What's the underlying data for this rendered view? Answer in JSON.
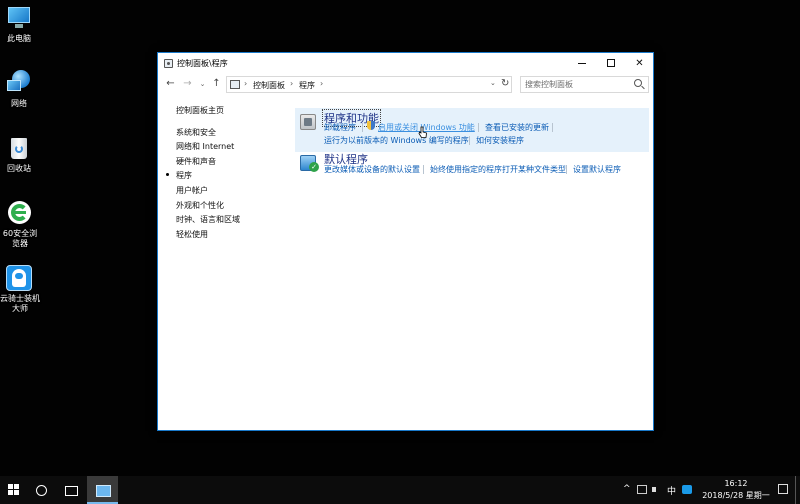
{
  "desktop": {
    "icons": [
      {
        "name": "this-pc",
        "label": "此电脑"
      },
      {
        "name": "network",
        "label": "网络"
      },
      {
        "name": "recycle-bin",
        "label": "回收站"
      },
      {
        "name": "browser-360",
        "label": "60安全浏览器"
      },
      {
        "name": "yunqishi",
        "label": "云骑士装机大师"
      }
    ]
  },
  "window": {
    "title": "控制面板\\程序",
    "address": {
      "crumbs": [
        "控制面板",
        "程序"
      ],
      "separator": "›"
    },
    "search_placeholder": "搜索控制面板",
    "left_pane": {
      "home": "控制面板主页",
      "items": [
        "系统和安全",
        "网络和 Internet",
        "硬件和声音",
        "程序",
        "用户帐户",
        "外观和个性化",
        "时钟、语言和区域",
        "轻松使用"
      ],
      "current": "程序"
    },
    "sections": [
      {
        "title": "程序和功能",
        "links_row1": [
          "卸载程序",
          "启用或关闭 Windows 功能",
          "查看已安装的更新"
        ],
        "links_row2": [
          "运行为以前版本的 Windows 编写的程序",
          "如何安装程序"
        ]
      },
      {
        "title": "默认程序",
        "links_row1": [
          "更改媒体或设备的默认设置",
          "始终使用指定的程序打开某种文件类型",
          "设置默认程序"
        ]
      }
    ]
  },
  "taskbar": {
    "ime": "中",
    "time": "16:12",
    "date": "2018/5/28 星期一"
  },
  "colors": {
    "desktop_bg": "#020202",
    "window_border": "#1979ca",
    "section_title": "#1e3287",
    "link": "#0b5cb5",
    "highlight": "#e5f1fb",
    "taskbar_bg": "#0c0c0c"
  }
}
